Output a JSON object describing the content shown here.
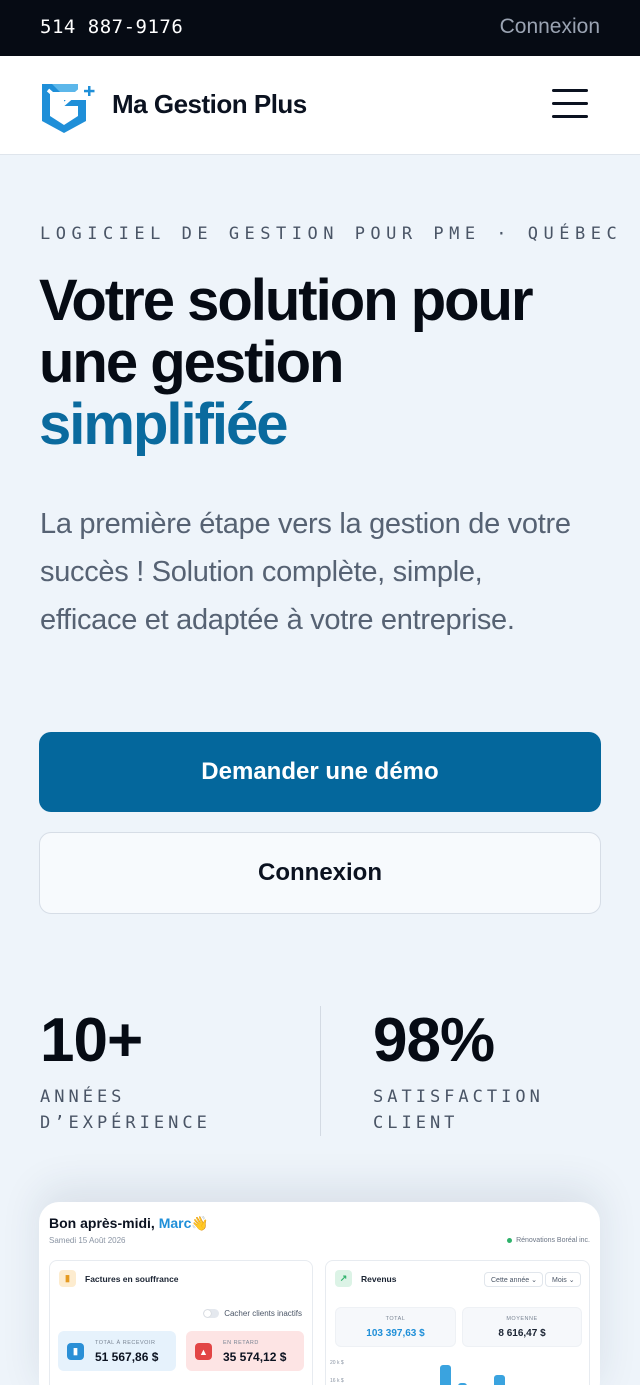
{
  "topbar": {
    "phone": "514 887-9176",
    "login_label": "Connexion"
  },
  "header": {
    "brand": "Ma Gestion Plus"
  },
  "hero": {
    "eyebrow": "LOGICIEL DE GESTION POUR PME · QUÉBEC",
    "headline_line1": "Votre solution pour",
    "headline_line2": "une gestion",
    "headline_accent": "simplifiée",
    "lead": "La première étape vers la gestion de votre succès ! Solution complète, simple, efficace et adaptée à votre entreprise.",
    "cta_primary": "Demander une démo",
    "cta_secondary": "Connexion"
  },
  "stats": [
    {
      "value": "10+",
      "label_line1": "ANNÉES",
      "label_line2": "D’EXPÉRIENCE"
    },
    {
      "value": "98%",
      "label_line1": "SATISFACTION",
      "label_line2": "CLIENT"
    }
  ],
  "dashboard": {
    "greeting": "Bon après-midi,",
    "user_name": "Marc",
    "wave_emoji": "👋",
    "date": "Samedi 15 Août 2026",
    "company": "Rénovations Boréal inc.",
    "invoices": {
      "title": "Factures en souffrance",
      "toggle_label": "Cacher clients inactifs",
      "total_caption": "TOTAL À RECEVOIR",
      "total_value": "51 567,86 $",
      "late_caption": "EN RETARD",
      "late_value": "35 574,12 $"
    },
    "revenue": {
      "title": "Revenus",
      "period_select": "Cette année",
      "granularity_select": "Mois",
      "total_caption": "TOTAL",
      "total_value": "103 397,63 $",
      "average_caption": "MOYENNE",
      "average_value": "8 616,47 $",
      "y_ticks": [
        "20 k $",
        "16 k $"
      ]
    }
  },
  "colors": {
    "accent": "#04679c",
    "headline_accent": "#0a6a9e",
    "topbar_bg": "#060b14",
    "page_bg": "#eef4fa"
  }
}
